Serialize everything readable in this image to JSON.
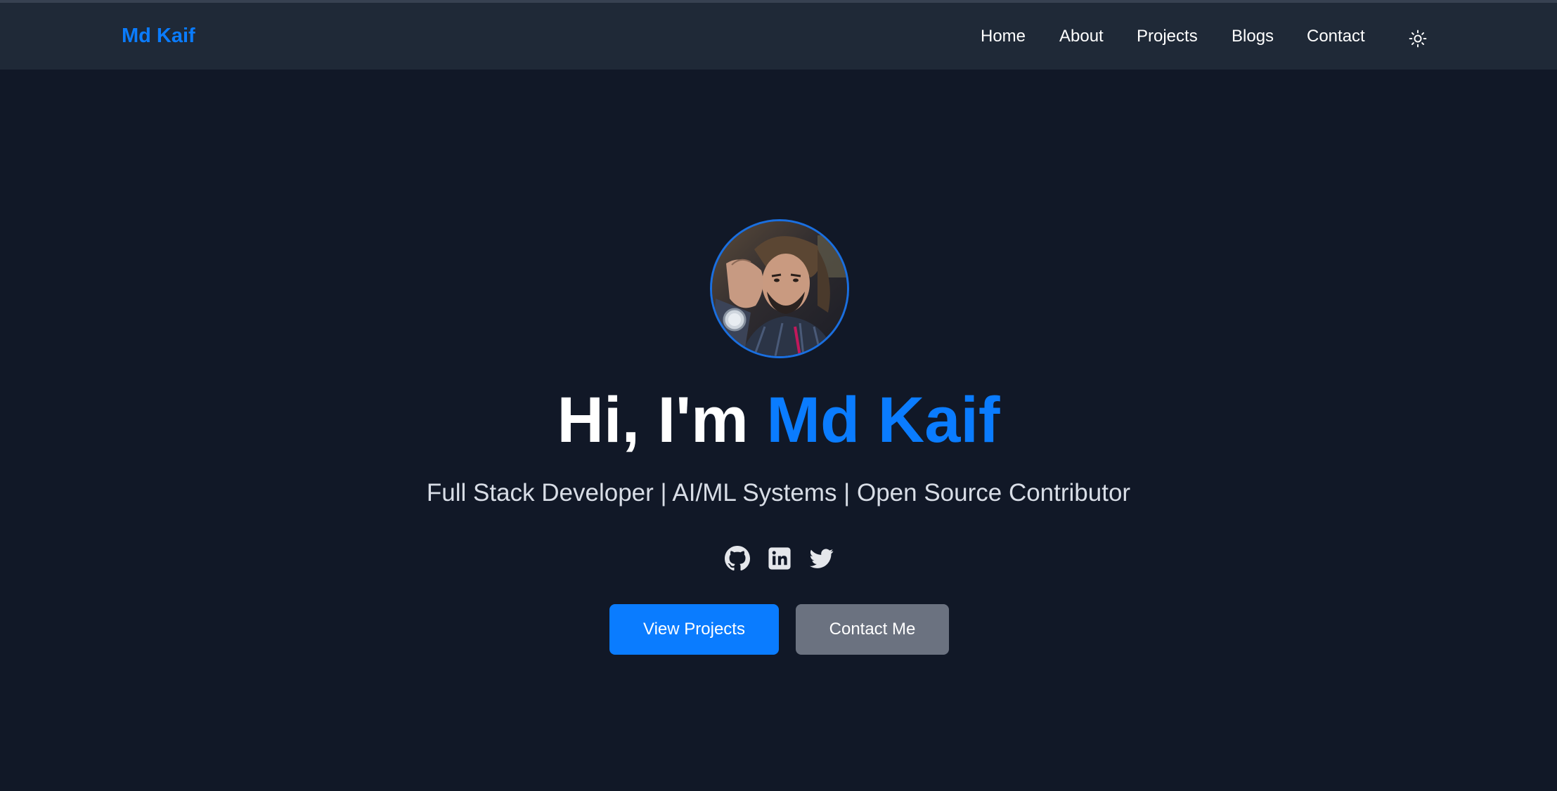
{
  "navbar": {
    "brand": "Md Kaif",
    "links": [
      {
        "label": "Home"
      },
      {
        "label": "About"
      },
      {
        "label": "Projects"
      },
      {
        "label": "Blogs"
      },
      {
        "label": "Contact"
      }
    ],
    "theme_toggle_icon": "sun-icon"
  },
  "hero": {
    "avatar_icon": "profile-photo",
    "greeting": "Hi, I'm ",
    "name": "Md Kaif",
    "tagline": "Full Stack Developer | AI/ML Systems | Open Source Contributor",
    "socials": [
      {
        "icon": "github-icon"
      },
      {
        "icon": "linkedin-icon"
      },
      {
        "icon": "twitter-icon"
      }
    ],
    "primary_button": "View Projects",
    "secondary_button": "Contact Me"
  },
  "colors": {
    "background": "#111827",
    "navbar": "#1f2937",
    "accent": "#0a7cff",
    "secondary_button": "#6b7280"
  }
}
